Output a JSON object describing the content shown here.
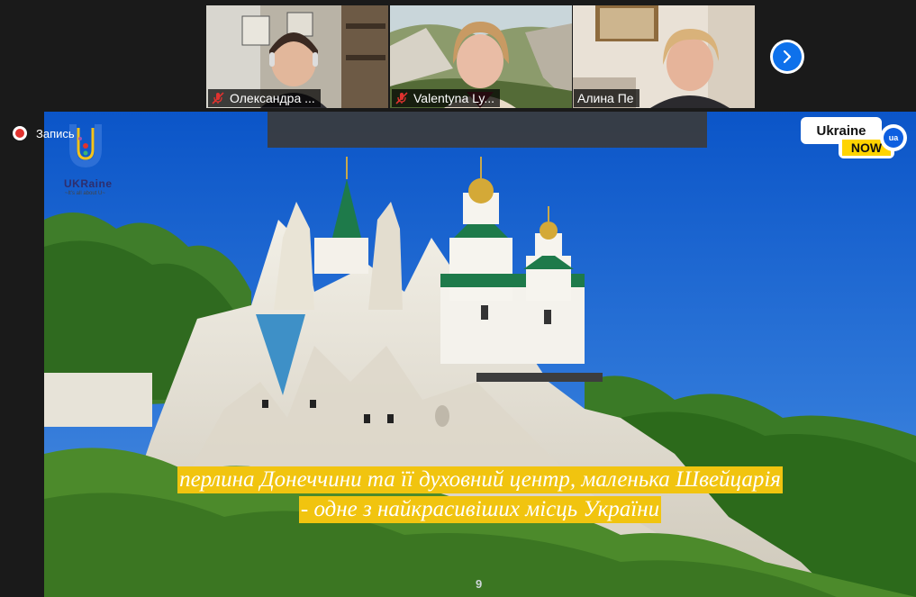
{
  "participants": [
    {
      "name": "Олександра ...",
      "muted": true
    },
    {
      "name": "Valentyna Ly...",
      "muted": true
    },
    {
      "name": "Алина Пе",
      "muted": false
    }
  ],
  "recording": {
    "label": "Запись"
  },
  "slide": {
    "brand_logo": {
      "word": "UKRaine",
      "tagline": "~It's all about U~"
    },
    "ukraine_now": {
      "word": "Ukraine",
      "now": "NOW",
      "ua": "ua"
    },
    "caption_lines": [
      "перлина Донеччини та її духовний центр, маленька Швейцарія",
      "- одне з найкрасивіших місць України"
    ],
    "page_number": "9"
  },
  "colors": {
    "accent_blue": "#0e71eb",
    "caption_highlight": "#f1c40f",
    "active_speaker": "#b6d32a",
    "record_red": "#e0322f"
  }
}
